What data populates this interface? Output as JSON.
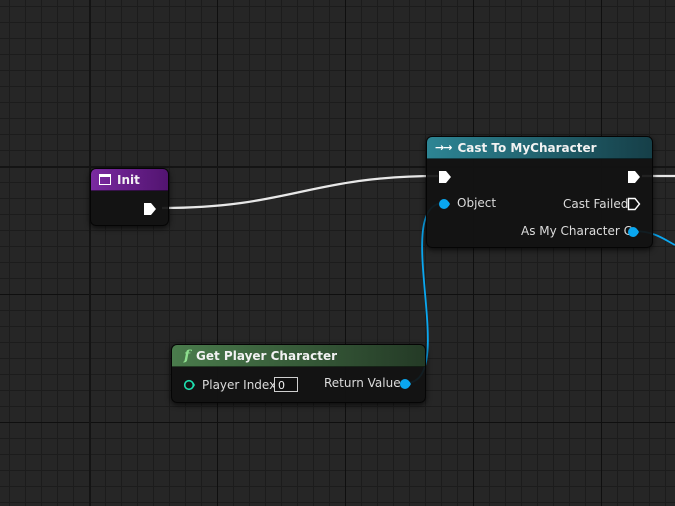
{
  "nodes": {
    "init": {
      "title": "Init",
      "icon": "event-icon",
      "header_color": "#6a1c8e"
    },
    "cast": {
      "title": "Cast To MyCharacter",
      "icon": "cast-arrows-icon",
      "header_color": "#1b6676",
      "object_label": "Object",
      "cast_failed_label": "Cast Failed",
      "as_character_label": "As My Character C"
    },
    "get_player": {
      "title": "Get Player Character",
      "icon": "function-icon",
      "icon_glyph": "f",
      "header_color": "#3d6a3f",
      "player_index_label": "Player Index",
      "player_index_value": "0",
      "return_value_label": "Return Value"
    }
  },
  "colors": {
    "exec_wire": "#e8e8e8",
    "object_wire": "#0aa7f0",
    "object_pin": "#0aa7f0",
    "integer_pin": "#1ee0b0"
  }
}
